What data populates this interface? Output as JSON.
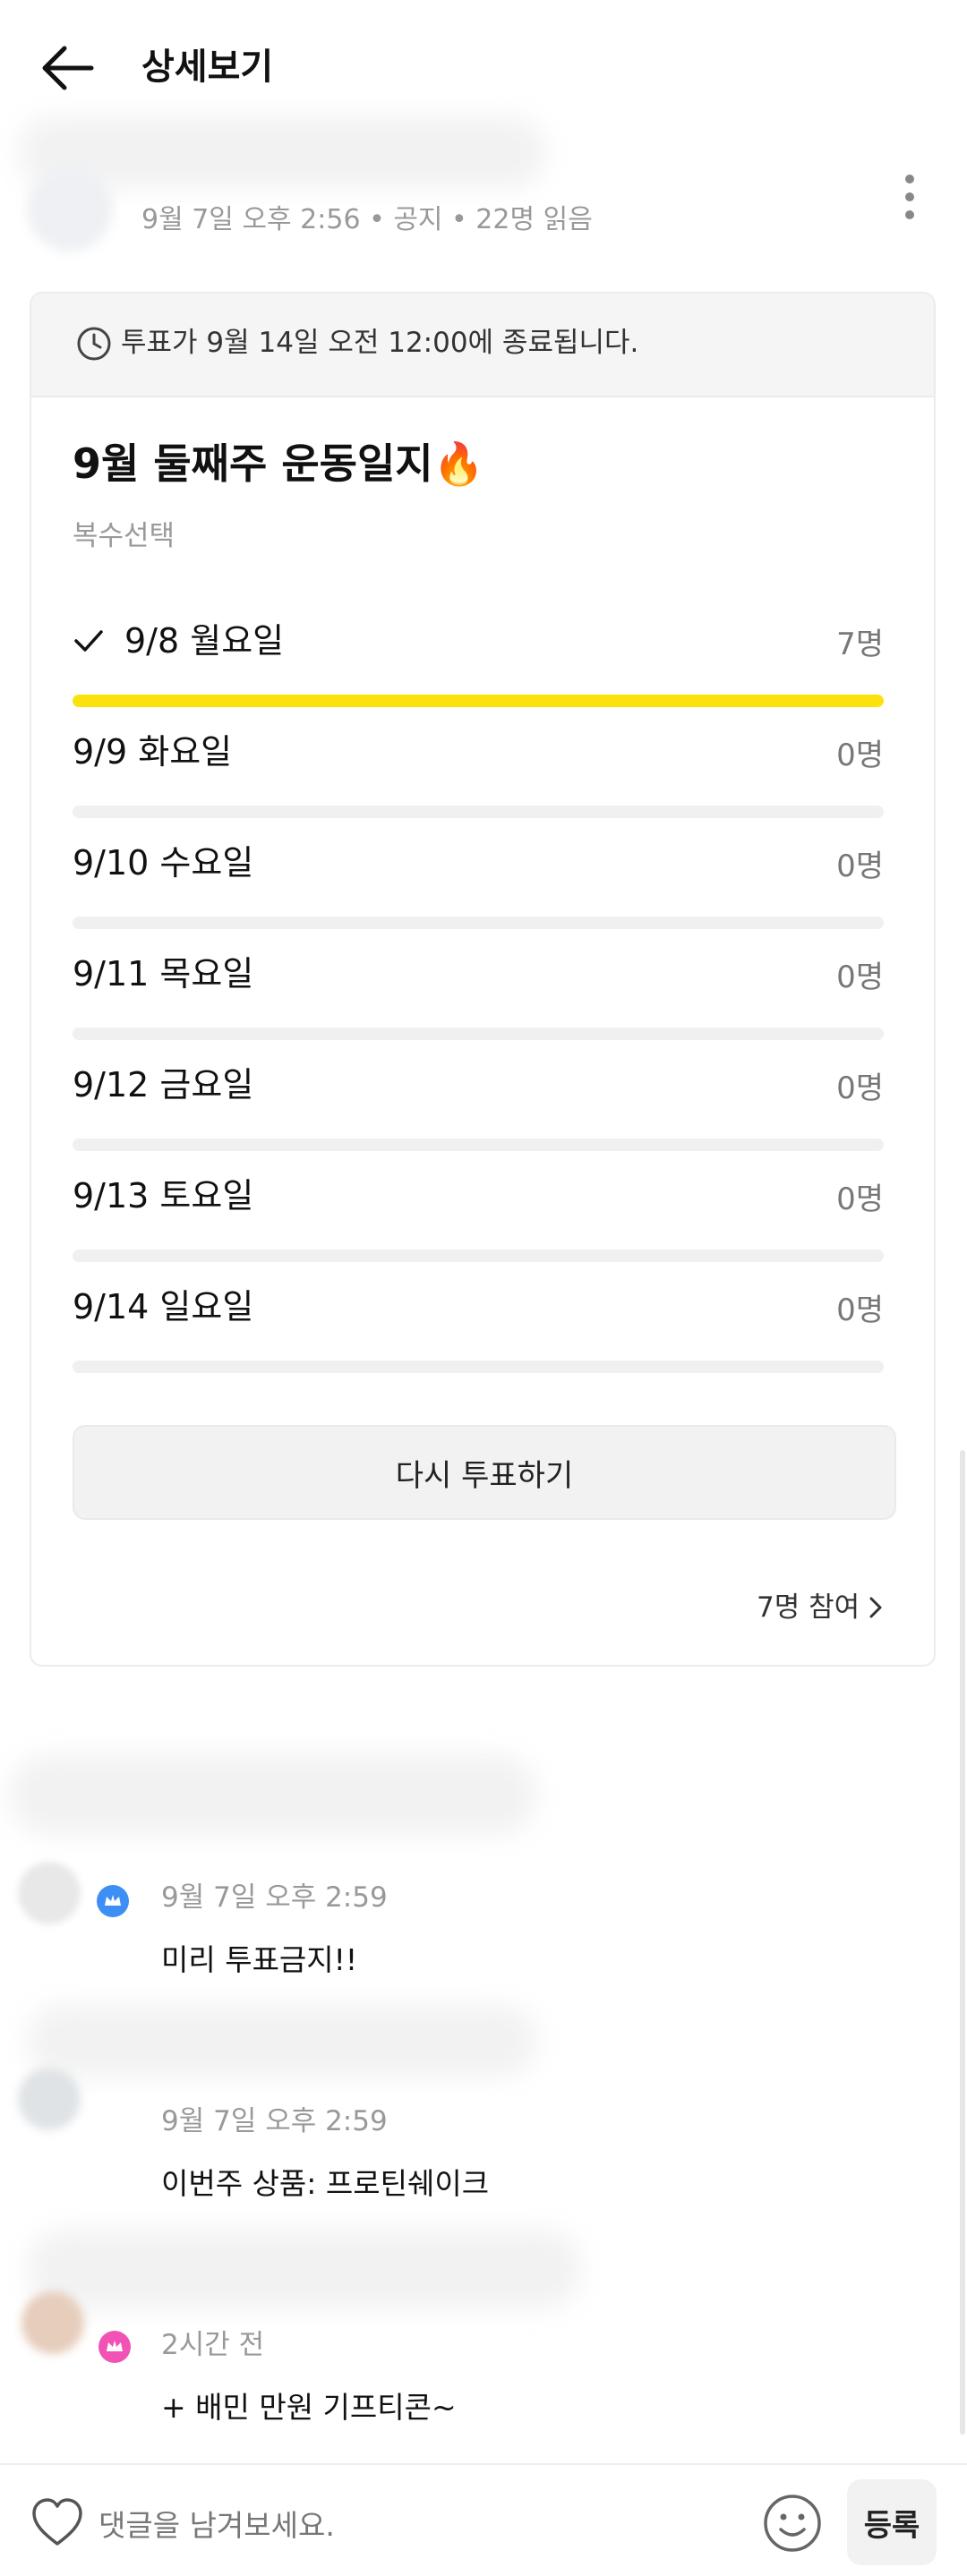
{
  "header": {
    "title": "상세보기"
  },
  "post": {
    "meta": "9월 7일 오후 2:56 • 공지 • 22명 읽음"
  },
  "poll": {
    "deadline": "투표가 9월 14일 오전 12:00에 종료됩니다.",
    "title": "9월 둘째주 운동일지🔥",
    "mode": "복수선택",
    "options": [
      {
        "label": "9/8 월요일",
        "count": "7명",
        "votes": 7,
        "selected": true
      },
      {
        "label": "9/9 화요일",
        "count": "0명",
        "votes": 0,
        "selected": false
      },
      {
        "label": "9/10 수요일",
        "count": "0명",
        "votes": 0,
        "selected": false
      },
      {
        "label": "9/11 목요일",
        "count": "0명",
        "votes": 0,
        "selected": false
      },
      {
        "label": "9/12 금요일",
        "count": "0명",
        "votes": 0,
        "selected": false
      },
      {
        "label": "9/13 토요일",
        "count": "0명",
        "votes": 0,
        "selected": false
      },
      {
        "label": "9/14 일요일",
        "count": "0명",
        "votes": 0,
        "selected": false
      }
    ],
    "revote_label": "다시 투표하기",
    "participants": "7명 참여"
  },
  "comments": [
    {
      "time": "9월 7일 오후 2:59",
      "text": "미리 투표금지!!",
      "badge_color": "#3d8ef5"
    },
    {
      "time": "9월 7일 오후 2:59",
      "text": "이번주 상품: 프로틴쉐이크",
      "badge_color": "#3d8ef5"
    },
    {
      "time": "2시간 전",
      "text": "+ 배민 만원 기프티콘~",
      "badge_color": "#f252b5"
    }
  ],
  "bottom": {
    "placeholder": "댓글을 남겨보세요.",
    "submit_label": "등록"
  },
  "colors": {
    "vote_bar": "#fbe20c",
    "track": "#f0f0f0"
  },
  "icons": [
    "back-arrow-icon",
    "more-vertical-icon",
    "clock-icon",
    "check-icon",
    "chevron-right-icon",
    "heart-icon",
    "smile-icon"
  ]
}
